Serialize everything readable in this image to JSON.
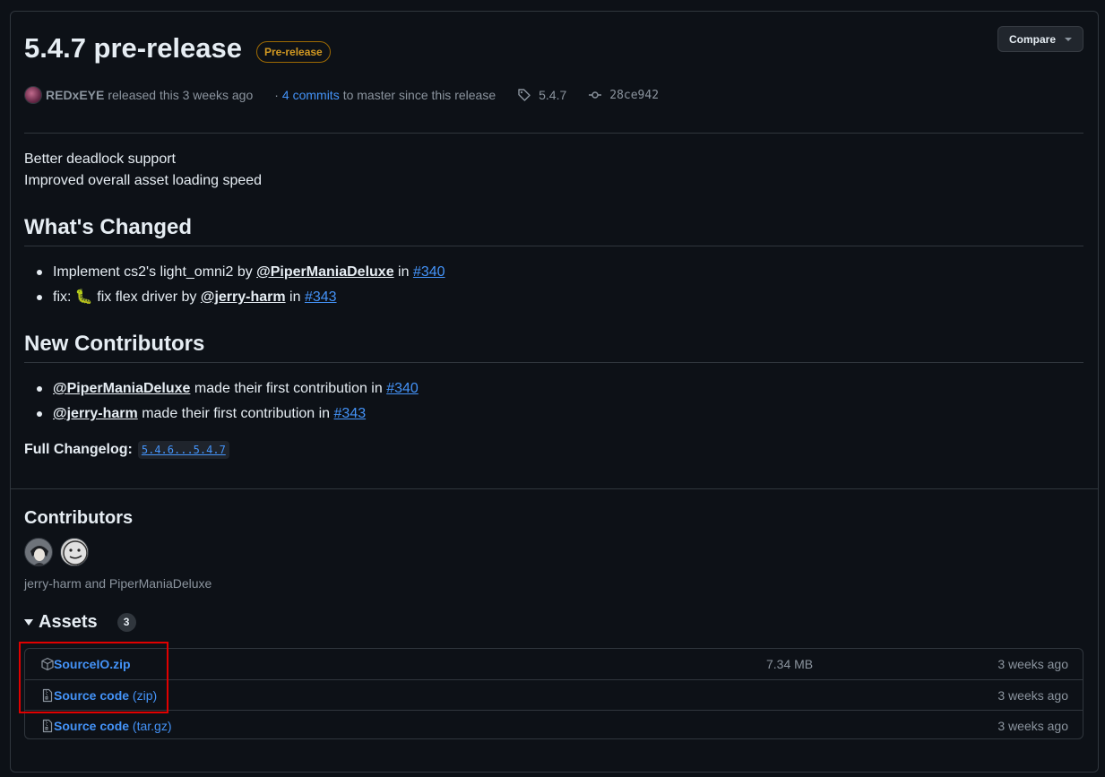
{
  "release": {
    "title": "5.4.7 pre-release",
    "badge": "Pre-release",
    "compare_label": "Compare",
    "author": "REDxEYE",
    "released_text": "released this 3 weeks ago",
    "commits_link": "4 commits",
    "commits_suffix": "to master since this release",
    "tag": "5.4.7",
    "commit": "28ce942"
  },
  "notes": {
    "line1": "Better deadlock support",
    "line2": "Improved overall asset loading speed",
    "whats_changed_title": "What's Changed",
    "changes": [
      {
        "prefix": "Implement cs2's light_omni2 by ",
        "user": "@PiperManiaDeluxe",
        "mid": " in ",
        "issue": "#340"
      },
      {
        "prefix": "fix: ",
        "emoji": "🐛",
        "text": " fix flex driver by ",
        "user": "@jerry-harm",
        "mid": " in ",
        "issue": "#343"
      }
    ],
    "new_contributors_title": "New Contributors",
    "new_contributors": [
      {
        "user": "@PiperManiaDeluxe",
        "text": " made their first contribution in ",
        "issue": "#340"
      },
      {
        "user": "@jerry-harm",
        "text": " made their first contribution in ",
        "issue": "#343"
      }
    ],
    "changelog_label": "Full Changelog:",
    "changelog_link": "5.4.6...5.4.7"
  },
  "contributors": {
    "title": "Contributors",
    "names": "jerry-harm and PiperManiaDeluxe"
  },
  "assets": {
    "title": "Assets",
    "count": "3",
    "items": [
      {
        "name": "SourceIO.zip",
        "ext": "",
        "size": "7.34 MB",
        "date": "3 weeks ago"
      },
      {
        "name": "Source code",
        "ext": "(zip)",
        "size": "",
        "date": "3 weeks ago"
      },
      {
        "name": "Source code",
        "ext": "(tar.gz)",
        "size": "",
        "date": "3 weeks ago"
      }
    ]
  },
  "colors": {
    "background": "#0d1117",
    "border": "#30363d",
    "link": "#4493f8",
    "muted": "#8b949e",
    "prerelease": "#d29922",
    "highlight": "#e00000"
  }
}
